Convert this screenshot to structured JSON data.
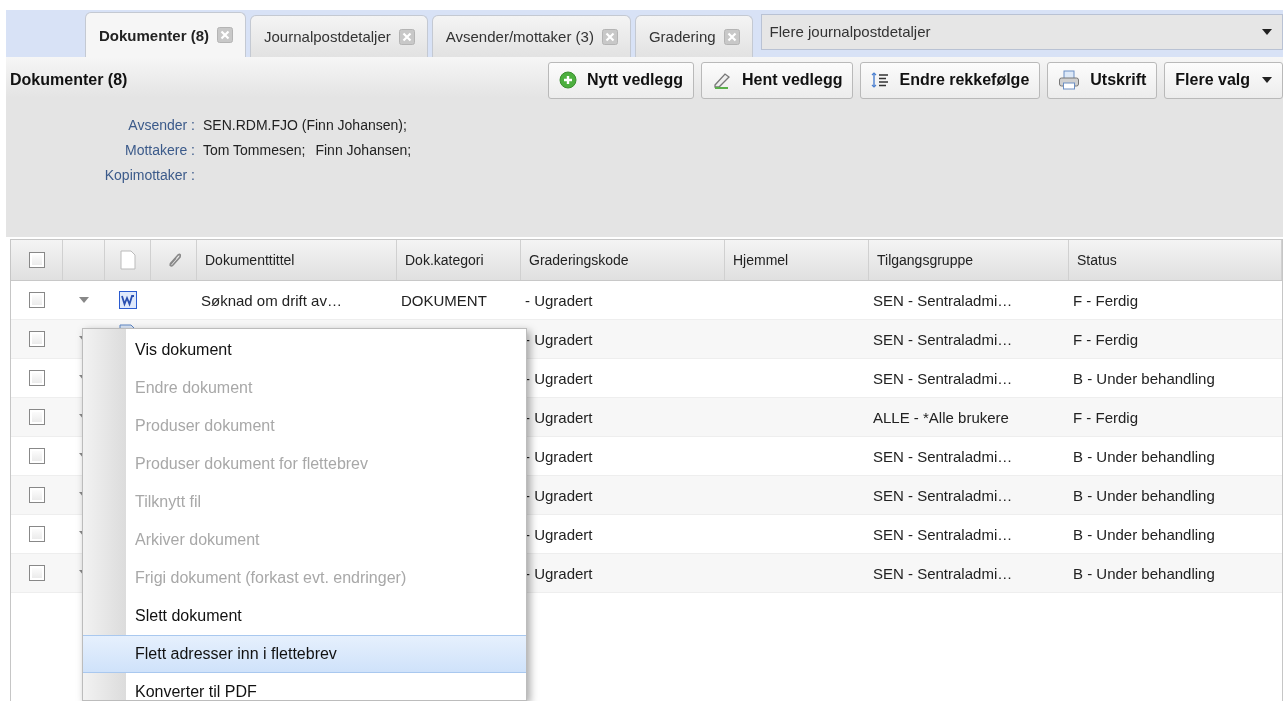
{
  "tabs": [
    {
      "label": "Dokumenter (8)",
      "selected": true
    },
    {
      "label": "Journalpostdetaljer",
      "selected": false
    },
    {
      "label": "Avsender/mottaker (3)",
      "selected": false
    },
    {
      "label": "Gradering",
      "selected": false
    }
  ],
  "tab_dropdown": {
    "label": "Flere journalpostdetaljer"
  },
  "toolbar": {
    "title": "Dokumenter (8)",
    "buttons": [
      {
        "kind": "add",
        "label": "Nytt vedlegg"
      },
      {
        "kind": "fetch",
        "label": "Hent vedlegg"
      },
      {
        "kind": "reorder",
        "label": "Endre rekkefølge"
      },
      {
        "kind": "print",
        "label": "Utskrift"
      },
      {
        "kind": "menu",
        "label": "Flere valg"
      }
    ]
  },
  "details": [
    {
      "label": "Avsender :",
      "values": [
        "SEN.RDM.FJO (Finn Johansen);"
      ]
    },
    {
      "label": "Mottakere :",
      "values": [
        "Tom Tommesen;",
        "Finn Johansen;"
      ]
    },
    {
      "label": "Kopimottaker :"
    }
  ],
  "table": {
    "header_checked": false,
    "columns": [
      "Dokumenttittel",
      "Dok.kategori",
      "Graderingskode",
      "Hjemmel",
      "Tilgangsgruppe",
      "Status"
    ],
    "rows": [
      {
        "checked": false,
        "kind": "word",
        "title": "Søknad om drift av…",
        "category": "DOKUMENT",
        "grading": "- Ugradert",
        "access": "SEN - Sentraladmi…",
        "status": "F - Ferdig"
      },
      {
        "checked": false,
        "kind": "document",
        "grading": "- Ugradert",
        "access": "SEN - Sentraladmi…",
        "status": "F - Ferdig"
      },
      {
        "checked": false,
        "grading": "- Ugradert",
        "access": "SEN - Sentraladmi…",
        "status": "B - Under behandling"
      },
      {
        "checked": false,
        "grading": "- Ugradert",
        "access": "ALLE - *Alle brukere",
        "status": "F - Ferdig"
      },
      {
        "checked": false,
        "grading": "- Ugradert",
        "access": "SEN - Sentraladmi…",
        "status": "B - Under behandling"
      },
      {
        "checked": false,
        "grading": "- Ugradert",
        "access": "SEN - Sentraladmi…",
        "status": "B - Under behandling"
      },
      {
        "checked": false,
        "grading": "- Ugradert",
        "access": "SEN - Sentraladmi…",
        "status": "B - Under behandling"
      },
      {
        "checked": false,
        "grading": "- Ugradert",
        "access": "SEN - Sentraladmi…",
        "status": "B - Under behandling"
      }
    ]
  },
  "context_menu": {
    "items": [
      {
        "label": "Vis dokument",
        "disabled": false,
        "selected": false
      },
      {
        "label": "Endre dokument",
        "disabled": true,
        "selected": false
      },
      {
        "label": "Produser dokument",
        "disabled": true,
        "selected": false
      },
      {
        "label": "Produser dokument for flettebrev",
        "disabled": true,
        "selected": false
      },
      {
        "label": "Tilknytt fil",
        "disabled": true,
        "selected": false
      },
      {
        "label": "Arkiver dokument",
        "disabled": true,
        "selected": false
      },
      {
        "label": "Frigi dokument (forkast evt. endringer)",
        "disabled": true,
        "selected": false
      },
      {
        "label": "Slett dokument",
        "disabled": false,
        "selected": false
      },
      {
        "label": "Flett adresser inn i flettebrev",
        "disabled": false,
        "selected": true
      },
      {
        "label": "Konverter til PDF",
        "disabled": false,
        "selected": false
      }
    ]
  }
}
